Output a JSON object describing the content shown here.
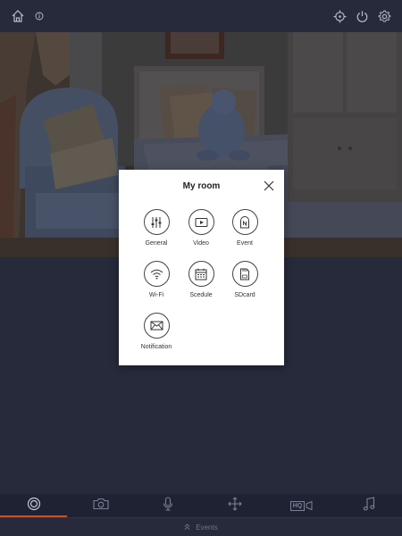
{
  "modal": {
    "title": "My room",
    "items": [
      {
        "label": "General"
      },
      {
        "label": "Video"
      },
      {
        "label": "Event"
      },
      {
        "label": "Wi-Fi"
      },
      {
        "label": "Scedule"
      },
      {
        "label": "SDcard"
      },
      {
        "label": "Notification"
      }
    ]
  },
  "bottom_toolbar": {
    "active_tab": "live-view",
    "quality_badge": "HQ"
  },
  "events_bar": {
    "label": "Events",
    "icon": "double-chevron-up-icon"
  },
  "icons": {
    "top_left": [
      "home-icon",
      "info-icon"
    ],
    "top_right": [
      "crosshair-icon",
      "power-icon",
      "gear-icon"
    ],
    "bottom": [
      "live-view-icon",
      "camera-icon",
      "microphone-icon",
      "move-arrows-icon",
      "hq-video-icon",
      "music-note-icon"
    ]
  },
  "colors": {
    "background": "#262a3a",
    "accent": "#c8502a"
  }
}
